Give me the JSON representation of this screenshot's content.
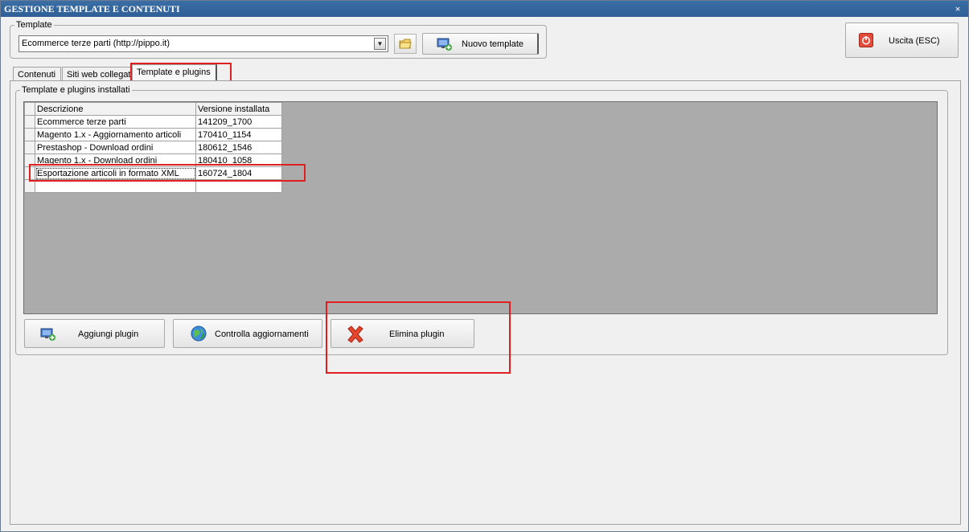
{
  "window": {
    "title": "GESTIONE TEMPLATE E CONTENUTI",
    "close_glyph": "×"
  },
  "template_section": {
    "group_label": "Template",
    "selected_value": "Ecommerce terze parti (http://pippo.it)",
    "nuovo_label": "Nuovo template"
  },
  "uscita": {
    "label": "Uscita (ESC)"
  },
  "tabs": [
    {
      "label": "Contenuti"
    },
    {
      "label": "Siti web collegati"
    },
    {
      "label": "Template e plugins",
      "active": true
    }
  ],
  "plugins": {
    "group_label": "Template e plugins installati",
    "columns": [
      "Descrizione",
      "Versione installata"
    ],
    "rows": [
      {
        "descrizione": "Ecommerce terze parti",
        "versione": "141209_1700"
      },
      {
        "descrizione": "Magento 1.x - Aggiornamento articoli",
        "versione": "170410_1154"
      },
      {
        "descrizione": "Prestashop - Download ordini",
        "versione": "180612_1546"
      },
      {
        "descrizione": "Magento 1.x - Download ordini",
        "versione": "180410_1058"
      },
      {
        "descrizione": "Esportazione articoli in formato XML",
        "versione": "160724_1804",
        "selected": true
      }
    ]
  },
  "buttons": {
    "aggiungi": "Aggiungi plugin",
    "controlla": "Controlla aggiornamenti",
    "elimina": "Elimina plugin"
  },
  "colors": {
    "titlebar": "#3a6ea5",
    "highlight": "#e02020",
    "grid_bg": "#ababab"
  },
  "icons": {
    "folder": "folder-icon",
    "add": "add-monitor-icon",
    "exit": "power-icon",
    "update": "globe-update-icon",
    "delete": "red-x-icon"
  }
}
